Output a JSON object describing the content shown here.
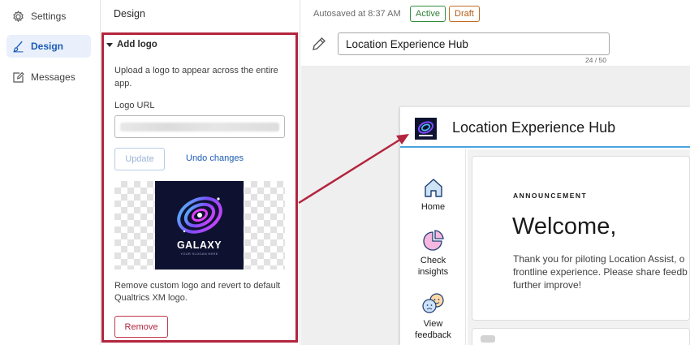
{
  "nav": {
    "items": [
      {
        "label": "Settings",
        "icon": "gear-icon",
        "active": false
      },
      {
        "label": "Design",
        "icon": "brush-icon",
        "active": true
      },
      {
        "label": "Messages",
        "icon": "edit-message-icon",
        "active": false
      }
    ]
  },
  "design_panel": {
    "title": "Design",
    "section_title": "Add logo",
    "description": "Upload a logo to appear across the entire app.",
    "url_label": "Logo URL",
    "url_value": "",
    "update_label": "Update",
    "undo_label": "Undo changes",
    "logo": {
      "name": "GALAXY",
      "tagline": "YOUR SLOGAN HERE"
    },
    "remove_description": "Remove custom logo and revert to default Qualtrics XM logo.",
    "remove_label": "Remove"
  },
  "header": {
    "autosave": "Autosaved at 8:37 AM",
    "status_active": "Active",
    "status_draft": "Draft",
    "project_name": "Location Experience Hub",
    "char_count": "24 / 50"
  },
  "preview": {
    "title": "Location Experience Hub",
    "nav": [
      {
        "label": "Home",
        "icon": "home-icon"
      },
      {
        "label": "Check insights",
        "icon": "pie-chart-icon"
      },
      {
        "label": "View feedback",
        "icon": "feedback-faces-icon"
      }
    ],
    "announcement_label": "ANNOUNCEMENT",
    "heading": "Welcome,",
    "body_lines": [
      "Thank you for piloting Location Assist, o",
      "frontline experience. Please share feedb",
      "further improve!"
    ]
  },
  "colors": {
    "accent": "#1c5cb5",
    "highlight": "#b3253d",
    "active_badge": "#2f8f3f",
    "draft_badge": "#c36b1e",
    "preview_accent": "#4aa3df"
  }
}
